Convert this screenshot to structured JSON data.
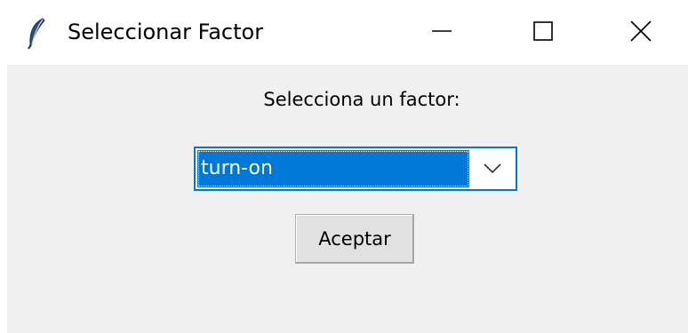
{
  "window": {
    "title": "Seleccionar Factor",
    "icons": {
      "app": "feather-icon",
      "minimize": "minimize-icon",
      "maximize": "maximize-icon",
      "close": "close-icon"
    }
  },
  "dialog": {
    "prompt": "Selecciona un factor:",
    "combobox": {
      "selected": "turn-on",
      "arrow_icon": "chevron-down-icon"
    },
    "accept_label": "Aceptar"
  },
  "colors": {
    "selection": "#0078d7",
    "client_bg": "#f0f0f0",
    "button_bg": "#e1e1e1"
  }
}
